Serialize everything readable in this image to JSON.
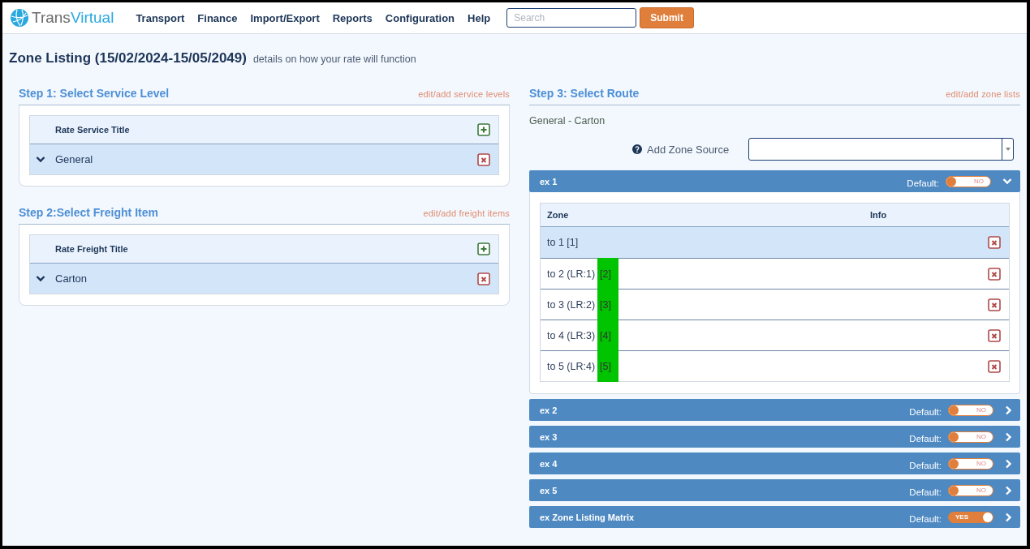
{
  "header": {
    "logo": {
      "text_1": "Trans",
      "text_2": "Virtual"
    },
    "menu": [
      "Transport",
      "Finance",
      "Import/Export",
      "Reports",
      "Configuration",
      "Help"
    ],
    "search": {
      "placeholder": "Search"
    },
    "submit": "Submit"
  },
  "page": {
    "title": "Zone Listing (15/02/2024-15/05/2049)",
    "subtitle": "details on how your rate will function"
  },
  "steps": [
    {
      "title": "Step 1: Select Service Level",
      "link": "edit/add service levels",
      "column": "Rate Service Title",
      "rows": [
        {
          "label": "General",
          "selected": true
        }
      ]
    },
    {
      "title": "Step 2:Select Freight Item",
      "link": "edit/add freight items",
      "column": "Rate Freight Title",
      "rows": [
        {
          "label": "Carton",
          "selected": true
        }
      ]
    }
  ],
  "route": {
    "title": "Step 3: Select Route",
    "link": "edit/add zone lists",
    "selection": "General - Carton",
    "zone_source_label": "Add Zone Source"
  },
  "zone_lists": [
    {
      "name": "ex 1",
      "default_label": "Default:",
      "default": {
        "on": false,
        "label": "NO"
      },
      "expanded": true,
      "columns": [
        "Zone",
        "Info"
      ],
      "rows": [
        {
          "zone": "to 1 [1]",
          "selected": true
        },
        {
          "zone": "to 2 (LR:1)",
          "code": "[2]",
          "highlighted": true,
          "selected": false
        },
        {
          "zone": "to 3 (LR:2)",
          "code": "[3]",
          "highlighted": true,
          "selected": false
        },
        {
          "zone": "to 4 (LR:3)",
          "code": "[4]",
          "highlighted": true,
          "selected": false
        },
        {
          "zone": "to 5 (LR:4)",
          "code": "[5]",
          "highlighted": true,
          "selected": false
        }
      ]
    },
    {
      "name": "ex 2",
      "default_label": "Default:",
      "default": {
        "on": false,
        "label": "NO"
      },
      "expanded": false
    },
    {
      "name": "ex 3",
      "default_label": "Default:",
      "default": {
        "on": false,
        "label": "NO"
      },
      "expanded": false
    },
    {
      "name": "ex 4",
      "default_label": "Default:",
      "default": {
        "on": false,
        "label": "NO"
      },
      "expanded": false
    },
    {
      "name": "ex 5",
      "default_label": "Default:",
      "default": {
        "on": false,
        "label": "NO"
      },
      "expanded": false
    },
    {
      "name": "ex Zone Listing Matrix",
      "default_label": "Default:",
      "default": {
        "on": true,
        "label": "YES"
      },
      "expanded": false
    }
  ]
}
